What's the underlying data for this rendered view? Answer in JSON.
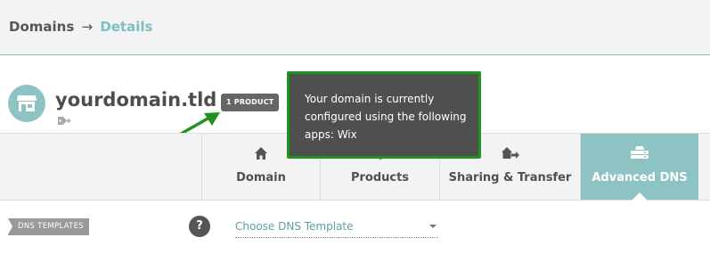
{
  "breadcrumb": {
    "parent": "Domains",
    "separator": "→",
    "current": "Details"
  },
  "domain": {
    "name": "yourdomain.tld",
    "product_badge": "1 PRODUCT"
  },
  "tooltip": {
    "text": "Your domain is currently configured using the following apps: Wix"
  },
  "tabs": [
    {
      "label": "Domain",
      "icon": "home-icon",
      "active": false
    },
    {
      "label": "Products",
      "icon": "box-icon",
      "active": false
    },
    {
      "label": "Sharing & Transfer",
      "icon": "share-transfer-icon",
      "active": false
    },
    {
      "label": "Advanced DNS",
      "icon": "dns-server-icon",
      "active": true
    }
  ],
  "dns_templates": {
    "label": "DNS TEMPLATES",
    "help": "?",
    "select_value": "Choose DNS Template"
  },
  "colors": {
    "accent": "#8ec3c4",
    "tooltip_bg": "#4f4f4f",
    "annotation_green": "#1f9322",
    "badge_bg": "#666666"
  }
}
